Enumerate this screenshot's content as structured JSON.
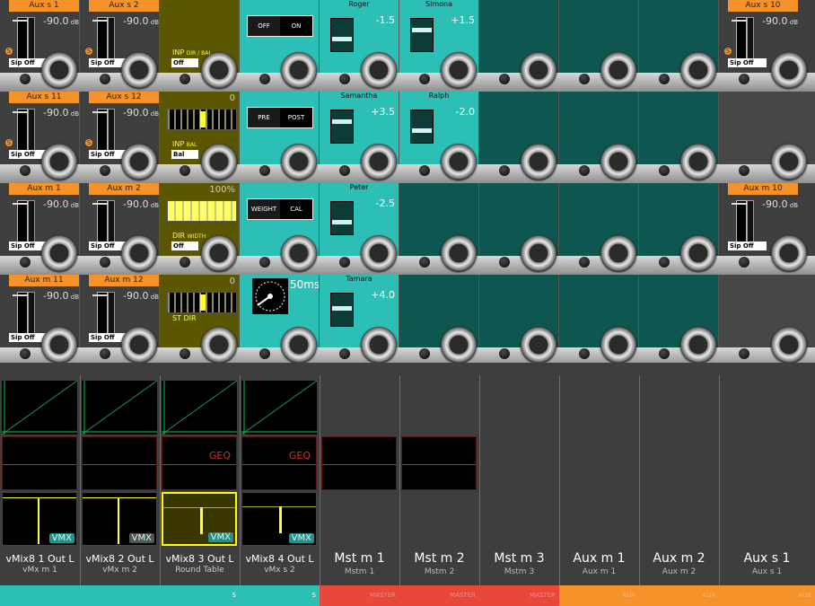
{
  "channels_row1": [
    {
      "header": "Aux s 1",
      "db": "-90.0",
      "unit": "dB",
      "solo": "S",
      "sip": "Sip Off"
    },
    {
      "header": "Aux s 2",
      "db": "-90.0",
      "unit": "dB",
      "solo": "S",
      "sip": "Sip Off"
    }
  ],
  "row1_inp": {
    "label": "INP",
    "sub": "DIR / BAL",
    "sel": "Off"
  },
  "row1_toggle": {
    "a": "OFF",
    "b": "ON"
  },
  "row1_pans": [
    {
      "name": "Roger",
      "value": "-1.5"
    },
    {
      "name": "Simona",
      "value": "+1.5"
    }
  ],
  "row1_right": {
    "header": "Aux s 10",
    "db": "-90.0",
    "unit": "dB",
    "solo": "S",
    "sip": "Sip Off"
  },
  "row2": [
    {
      "header": "Aux s 11",
      "db": "-90.0",
      "unit": "dB",
      "solo": "S",
      "sip": "Sip Off"
    },
    {
      "header": "Aux s 12",
      "db": "-90.0",
      "unit": "dB",
      "solo": "S",
      "sip": "Sip Off"
    }
  ],
  "row2_inp": {
    "label": "INP",
    "sub": "BAL",
    "sel": "Bal",
    "value": "0"
  },
  "row2_toggle": {
    "a": "PRE",
    "b": "POST"
  },
  "row2_pans": [
    {
      "name": "Samantha",
      "value": "+3.5"
    },
    {
      "name": "Ralph",
      "value": "-2.0"
    }
  ],
  "row3": [
    {
      "header": "Aux m 1",
      "db": "-90.0",
      "unit": "dB",
      "sip": "Sip Off"
    },
    {
      "header": "Aux m 2",
      "db": "-90.0",
      "unit": "dB",
      "sip": "Sip Off"
    }
  ],
  "row3_dir": {
    "label": "DIR",
    "sub": "WIDTH",
    "sel": "Off",
    "value": "100%"
  },
  "row3_toggle": {
    "a": "WEIGHT",
    "b": "CAL"
  },
  "row3_pan": {
    "name": "Peter",
    "value": "-2.5"
  },
  "row3_right": {
    "header": "Aux m 10",
    "db": "-90.0",
    "unit": "dB",
    "sip": "Sip Off"
  },
  "row4": [
    {
      "header": "Aux m 11",
      "db": "-90.0",
      "unit": "dB",
      "sip": "Sip Off"
    },
    {
      "header": "Aux m 12",
      "db": "-90.0",
      "unit": "dB",
      "sip": "Sip Off"
    }
  ],
  "row4_st": {
    "label": "ST DIR",
    "value": "0"
  },
  "row4_delay": "50ms",
  "row4_pan": {
    "name": "Tamara",
    "value": "+4.0"
  },
  "strips": [
    {
      "name": "vMix8 1 Out L",
      "sub": "vMx m 1",
      "badge": "VMX"
    },
    {
      "name": "vMix8 2 Out L",
      "sub": "vMx m 2",
      "badge": "VMX"
    },
    {
      "name": "vMix8 3 Out L",
      "sub": "Round Table",
      "badge": "VMX"
    },
    {
      "name": "vMix8 4 Out L",
      "sub": "vMx s 2",
      "badge": "VMX"
    }
  ],
  "geq_label": "GEQ",
  "masters": [
    {
      "name": "Mst m 1",
      "sub": "Mstm 1"
    },
    {
      "name": "Mst m 2",
      "sub": "Mstm 2"
    },
    {
      "name": "Mst m 3",
      "sub": "Mstm 3"
    },
    {
      "name": "Aux m 1",
      "sub": "Aux m 1"
    },
    {
      "name": "Aux m 2",
      "sub": "Aux m 2"
    },
    {
      "name": "Aux s 1",
      "sub": "Aux s 1"
    }
  ],
  "footers": [
    "",
    "",
    "S",
    "S",
    "MASTER",
    "MASTER",
    "MASTER",
    "AUX",
    "AUX",
    "AUX"
  ],
  "colors": {
    "teal": "#2bbfb6",
    "orange": "#f5922a",
    "red": "#e8473a",
    "olive": "#5b5700"
  }
}
